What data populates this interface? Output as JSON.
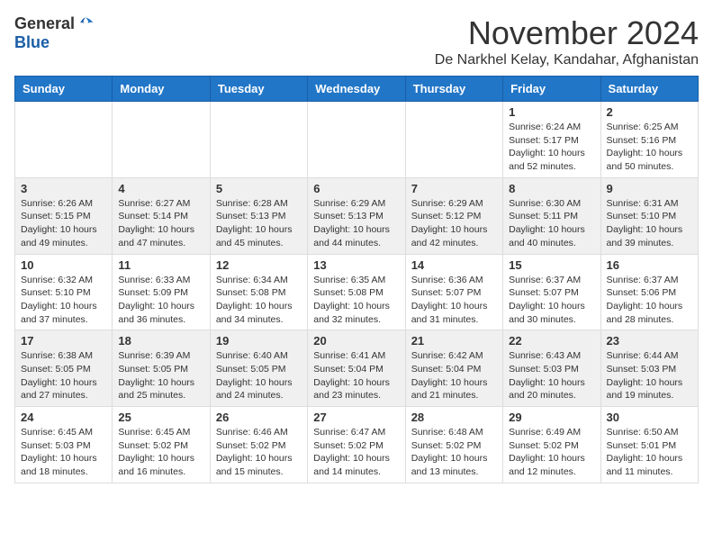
{
  "header": {
    "logo_general": "General",
    "logo_blue": "Blue",
    "month_title": "November 2024",
    "location": "De Narkhel Kelay, Kandahar, Afghanistan"
  },
  "weekdays": [
    "Sunday",
    "Monday",
    "Tuesday",
    "Wednesday",
    "Thursday",
    "Friday",
    "Saturday"
  ],
  "weeks": [
    [
      {
        "day": "",
        "info": ""
      },
      {
        "day": "",
        "info": ""
      },
      {
        "day": "",
        "info": ""
      },
      {
        "day": "",
        "info": ""
      },
      {
        "day": "",
        "info": ""
      },
      {
        "day": "1",
        "info": "Sunrise: 6:24 AM\nSunset: 5:17 PM\nDaylight: 10 hours\nand 52 minutes."
      },
      {
        "day": "2",
        "info": "Sunrise: 6:25 AM\nSunset: 5:16 PM\nDaylight: 10 hours\nand 50 minutes."
      }
    ],
    [
      {
        "day": "3",
        "info": "Sunrise: 6:26 AM\nSunset: 5:15 PM\nDaylight: 10 hours\nand 49 minutes."
      },
      {
        "day": "4",
        "info": "Sunrise: 6:27 AM\nSunset: 5:14 PM\nDaylight: 10 hours\nand 47 minutes."
      },
      {
        "day": "5",
        "info": "Sunrise: 6:28 AM\nSunset: 5:13 PM\nDaylight: 10 hours\nand 45 minutes."
      },
      {
        "day": "6",
        "info": "Sunrise: 6:29 AM\nSunset: 5:13 PM\nDaylight: 10 hours\nand 44 minutes."
      },
      {
        "day": "7",
        "info": "Sunrise: 6:29 AM\nSunset: 5:12 PM\nDaylight: 10 hours\nand 42 minutes."
      },
      {
        "day": "8",
        "info": "Sunrise: 6:30 AM\nSunset: 5:11 PM\nDaylight: 10 hours\nand 40 minutes."
      },
      {
        "day": "9",
        "info": "Sunrise: 6:31 AM\nSunset: 5:10 PM\nDaylight: 10 hours\nand 39 minutes."
      }
    ],
    [
      {
        "day": "10",
        "info": "Sunrise: 6:32 AM\nSunset: 5:10 PM\nDaylight: 10 hours\nand 37 minutes."
      },
      {
        "day": "11",
        "info": "Sunrise: 6:33 AM\nSunset: 5:09 PM\nDaylight: 10 hours\nand 36 minutes."
      },
      {
        "day": "12",
        "info": "Sunrise: 6:34 AM\nSunset: 5:08 PM\nDaylight: 10 hours\nand 34 minutes."
      },
      {
        "day": "13",
        "info": "Sunrise: 6:35 AM\nSunset: 5:08 PM\nDaylight: 10 hours\nand 32 minutes."
      },
      {
        "day": "14",
        "info": "Sunrise: 6:36 AM\nSunset: 5:07 PM\nDaylight: 10 hours\nand 31 minutes."
      },
      {
        "day": "15",
        "info": "Sunrise: 6:37 AM\nSunset: 5:07 PM\nDaylight: 10 hours\nand 30 minutes."
      },
      {
        "day": "16",
        "info": "Sunrise: 6:37 AM\nSunset: 5:06 PM\nDaylight: 10 hours\nand 28 minutes."
      }
    ],
    [
      {
        "day": "17",
        "info": "Sunrise: 6:38 AM\nSunset: 5:05 PM\nDaylight: 10 hours\nand 27 minutes."
      },
      {
        "day": "18",
        "info": "Sunrise: 6:39 AM\nSunset: 5:05 PM\nDaylight: 10 hours\nand 25 minutes."
      },
      {
        "day": "19",
        "info": "Sunrise: 6:40 AM\nSunset: 5:05 PM\nDaylight: 10 hours\nand 24 minutes."
      },
      {
        "day": "20",
        "info": "Sunrise: 6:41 AM\nSunset: 5:04 PM\nDaylight: 10 hours\nand 23 minutes."
      },
      {
        "day": "21",
        "info": "Sunrise: 6:42 AM\nSunset: 5:04 PM\nDaylight: 10 hours\nand 21 minutes."
      },
      {
        "day": "22",
        "info": "Sunrise: 6:43 AM\nSunset: 5:03 PM\nDaylight: 10 hours\nand 20 minutes."
      },
      {
        "day": "23",
        "info": "Sunrise: 6:44 AM\nSunset: 5:03 PM\nDaylight: 10 hours\nand 19 minutes."
      }
    ],
    [
      {
        "day": "24",
        "info": "Sunrise: 6:45 AM\nSunset: 5:03 PM\nDaylight: 10 hours\nand 18 minutes."
      },
      {
        "day": "25",
        "info": "Sunrise: 6:45 AM\nSunset: 5:02 PM\nDaylight: 10 hours\nand 16 minutes."
      },
      {
        "day": "26",
        "info": "Sunrise: 6:46 AM\nSunset: 5:02 PM\nDaylight: 10 hours\nand 15 minutes."
      },
      {
        "day": "27",
        "info": "Sunrise: 6:47 AM\nSunset: 5:02 PM\nDaylight: 10 hours\nand 14 minutes."
      },
      {
        "day": "28",
        "info": "Sunrise: 6:48 AM\nSunset: 5:02 PM\nDaylight: 10 hours\nand 13 minutes."
      },
      {
        "day": "29",
        "info": "Sunrise: 6:49 AM\nSunset: 5:02 PM\nDaylight: 10 hours\nand 12 minutes."
      },
      {
        "day": "30",
        "info": "Sunrise: 6:50 AM\nSunset: 5:01 PM\nDaylight: 10 hours\nand 11 minutes."
      }
    ]
  ]
}
